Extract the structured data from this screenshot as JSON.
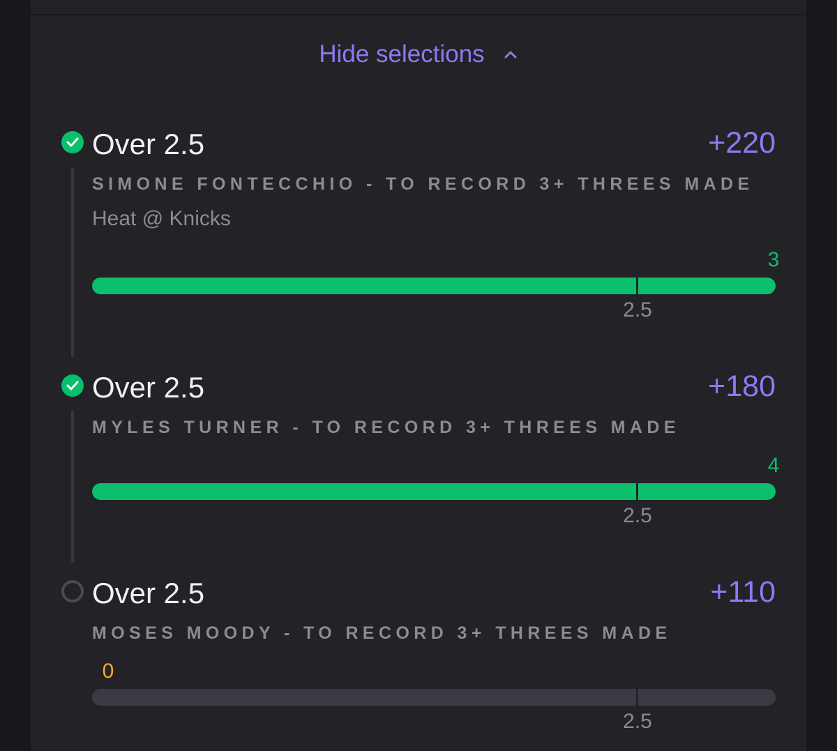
{
  "toggle": {
    "label": "Hide selections",
    "icon": "chevron-up-icon"
  },
  "colors": {
    "accent": "#8f79f2",
    "won": "#0bbf6c",
    "pending_result": "#f0a92a",
    "muted": "#8c8b95",
    "track": "#3b3a42"
  },
  "selections": [
    {
      "status": "won",
      "status_icon": "check-circle-icon",
      "title": "Over 2.5",
      "odds": "+220",
      "market": "SIMONE FONTECCHIO - TO RECORD 3+ THREES MADE",
      "event": "Heat @ Knicks",
      "result": "3",
      "result_value": 3,
      "line": "2.5",
      "line_value": 2.5,
      "progress": 1.0
    },
    {
      "status": "won",
      "status_icon": "check-circle-icon",
      "title": "Over 2.5",
      "odds": "+180",
      "market": "MYLES TURNER - TO RECORD 3+ THREES MADE",
      "result": "4",
      "result_value": 4,
      "line": "2.5",
      "line_value": 2.5,
      "progress": 1.0
    },
    {
      "status": "pending",
      "status_icon": "empty-circle-icon",
      "title": "Over 2.5",
      "odds": "+110",
      "market": "MOSES MOODY - TO RECORD 3+ THREES MADE",
      "result": "0",
      "result_value": 0,
      "line": "2.5",
      "line_value": 2.5,
      "progress": 0.0
    }
  ]
}
